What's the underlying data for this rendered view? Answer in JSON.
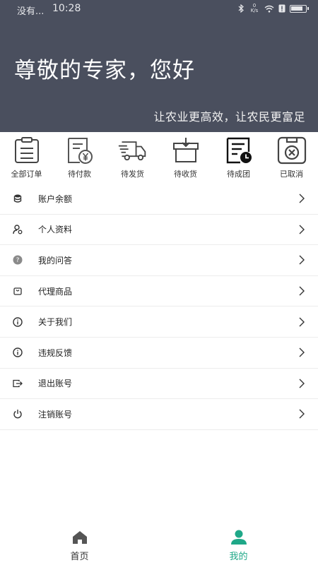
{
  "status_bar": {
    "carrier": "没有...",
    "time": "10:28",
    "network_speed": "0 K/s"
  },
  "header": {
    "greeting": "尊敬的专家，您好",
    "slogan": "让农业更高效，让农民更富足",
    "background_color": "#4a4f5e"
  },
  "orders": {
    "items": [
      {
        "label": "全部订单",
        "icon": "clipboard-icon"
      },
      {
        "label": "待付款",
        "icon": "yen-receipt-icon"
      },
      {
        "label": "待发货",
        "icon": "delivery-truck-icon"
      },
      {
        "label": "待收货",
        "icon": "package-box-icon"
      },
      {
        "label": "待成团",
        "icon": "document-clock-icon"
      },
      {
        "label": "已取消",
        "icon": "cancel-x-icon"
      }
    ]
  },
  "menu": {
    "items": [
      {
        "label": "账户余额",
        "icon": "database-coins-icon"
      },
      {
        "label": "个人资料",
        "icon": "user-settings-icon"
      },
      {
        "label": "我的问答",
        "icon": "question-circle-icon"
      },
      {
        "label": "代理商品",
        "icon": "shopping-bag-icon"
      },
      {
        "label": "关于我们",
        "icon": "info-icon"
      },
      {
        "label": "违规反馈",
        "icon": "info-icon"
      },
      {
        "label": "退出账号",
        "icon": "logout-icon"
      },
      {
        "label": "注销账号",
        "icon": "power-icon"
      }
    ]
  },
  "tabbar": {
    "home_label": "首页",
    "mine_label": "我的",
    "active_color": "#1fa888",
    "inactive_color": "#555555"
  }
}
